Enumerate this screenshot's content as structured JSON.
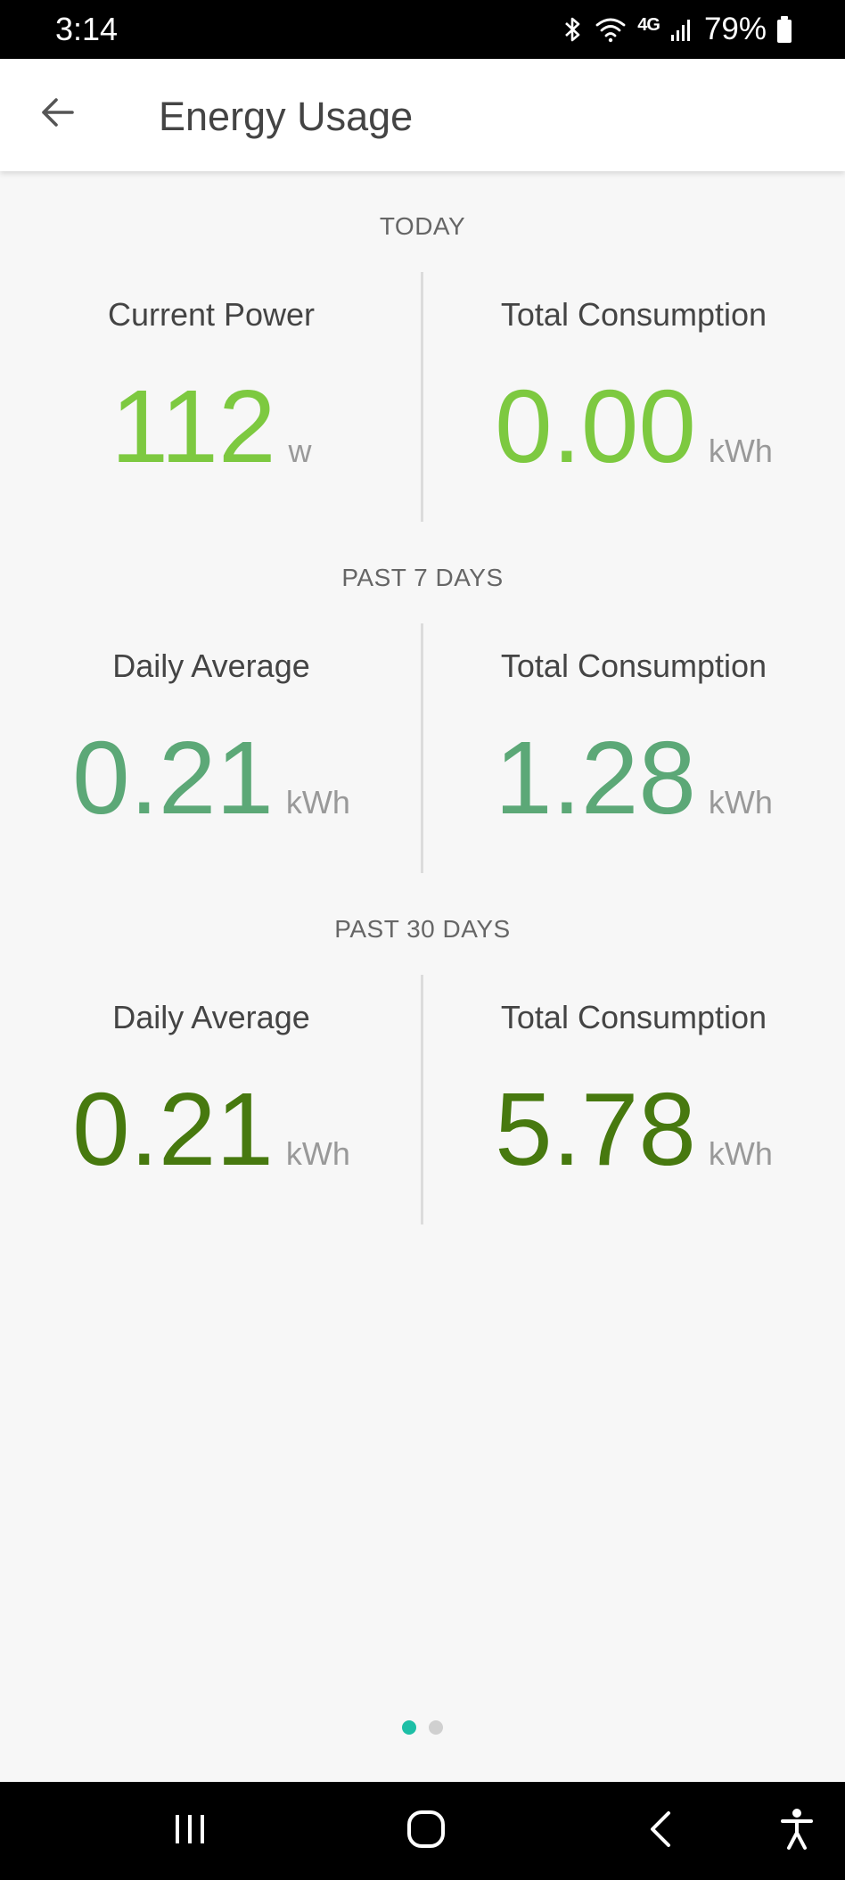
{
  "status_bar": {
    "time": "3:14",
    "network": "4G",
    "battery_percent": "79%"
  },
  "app_bar": {
    "title": "Energy Usage"
  },
  "sections": [
    {
      "header": "TODAY",
      "color": "#7dc940",
      "left": {
        "label": "Current Power",
        "value": "112",
        "unit": "w"
      },
      "right": {
        "label": "Total Consumption",
        "value": "0.00",
        "unit": "kWh"
      }
    },
    {
      "header": "PAST 7 DAYS",
      "color": "#5ca877",
      "left": {
        "label": "Daily Average",
        "value": "0.21",
        "unit": "kWh"
      },
      "right": {
        "label": "Total Consumption",
        "value": "1.28",
        "unit": "kWh"
      }
    },
    {
      "header": "PAST 30 DAYS",
      "color": "#47790f",
      "left": {
        "label": "Daily Average",
        "value": "0.21",
        "unit": "kWh"
      },
      "right": {
        "label": "Total Consumption",
        "value": "5.78",
        "unit": "kWh"
      }
    }
  ],
  "page_indicator": {
    "pages": 2,
    "active": 0,
    "active_color": "#1dbfa6",
    "inactive_color": "#d0d0d0"
  },
  "icons": {
    "back": "arrow-left-icon",
    "bluetooth": "bluetooth-icon",
    "wifi": "wifi-icon",
    "signal": "signal-icon",
    "battery": "battery-icon",
    "nav_recents": "recents-icon",
    "nav_home": "home-icon",
    "nav_back": "chevron-left-icon",
    "nav_accessibility": "accessibility-icon"
  }
}
